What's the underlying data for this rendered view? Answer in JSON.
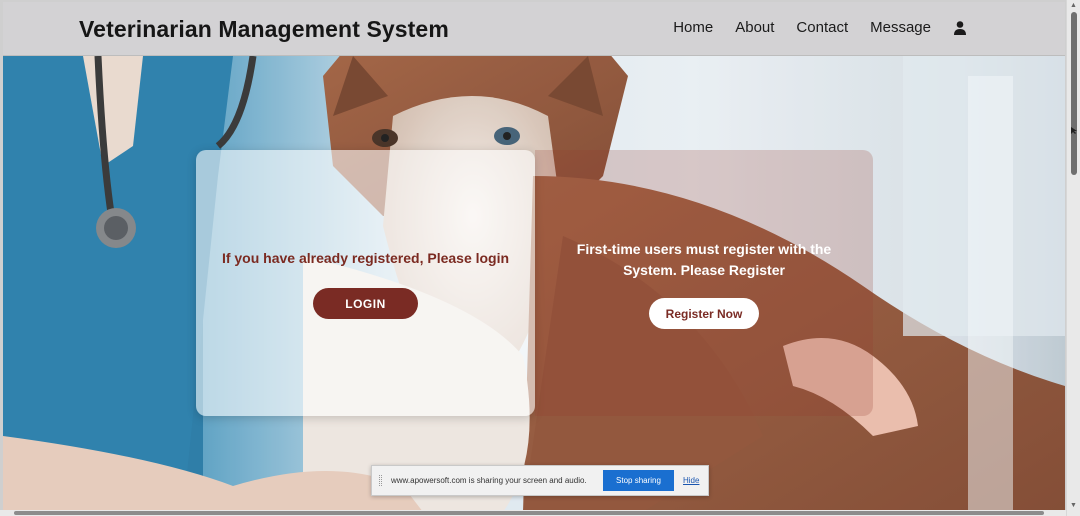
{
  "navbar": {
    "brand": "Veterinarian Management System",
    "links": [
      "Home",
      "About",
      "Contact",
      "Message"
    ],
    "user_icon": "user-icon"
  },
  "login_panel": {
    "text": "If you have already registered, Please login",
    "button": "LOGIN"
  },
  "register_panel": {
    "text": "First-time users must register with the System. Please Register",
    "button": "Register Now"
  },
  "share_bar": {
    "text": "www.apowersoft.com is sharing your screen and audio.",
    "stop_button": "Stop sharing",
    "hide_link": "Hide"
  },
  "colors": {
    "accent": "#7a2b24",
    "navbar_bg": "#d3d2d4",
    "share_button": "#1a6fd0"
  }
}
